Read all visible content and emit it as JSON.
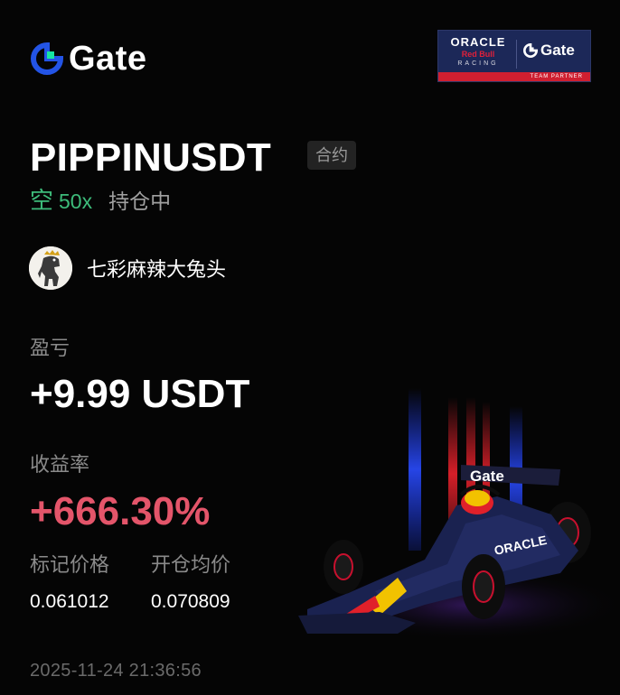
{
  "brand": {
    "logo_text": "Gate",
    "accent_color": "#2354e6",
    "highlight_color": "#17e6a1"
  },
  "partner_badge": {
    "oracle": "ORACLE",
    "redbull": "Red Bull",
    "racing": "RACING",
    "gate": "Gate",
    "strip_text": "TEAM PARTNER"
  },
  "position": {
    "pair": "PIPPINUSDT",
    "market_type": "合约",
    "side": "空",
    "leverage": "50x",
    "status": "持仓中"
  },
  "user": {
    "name": "七彩麻辣大兔头"
  },
  "pnl": {
    "label": "盈亏",
    "value": "+9.99 USDT"
  },
  "roi": {
    "label": "收益率",
    "value": "+666.30%"
  },
  "prices": {
    "mark_label": "标记价格",
    "mark_value": "0.061012",
    "entry_label": "开仓均价",
    "entry_value": "0.070809"
  },
  "timestamp": "2025-11-24 21:36:56",
  "colors": {
    "short_green": "#3dbb7a",
    "profit_red": "#e4556a",
    "background": "#050505"
  }
}
